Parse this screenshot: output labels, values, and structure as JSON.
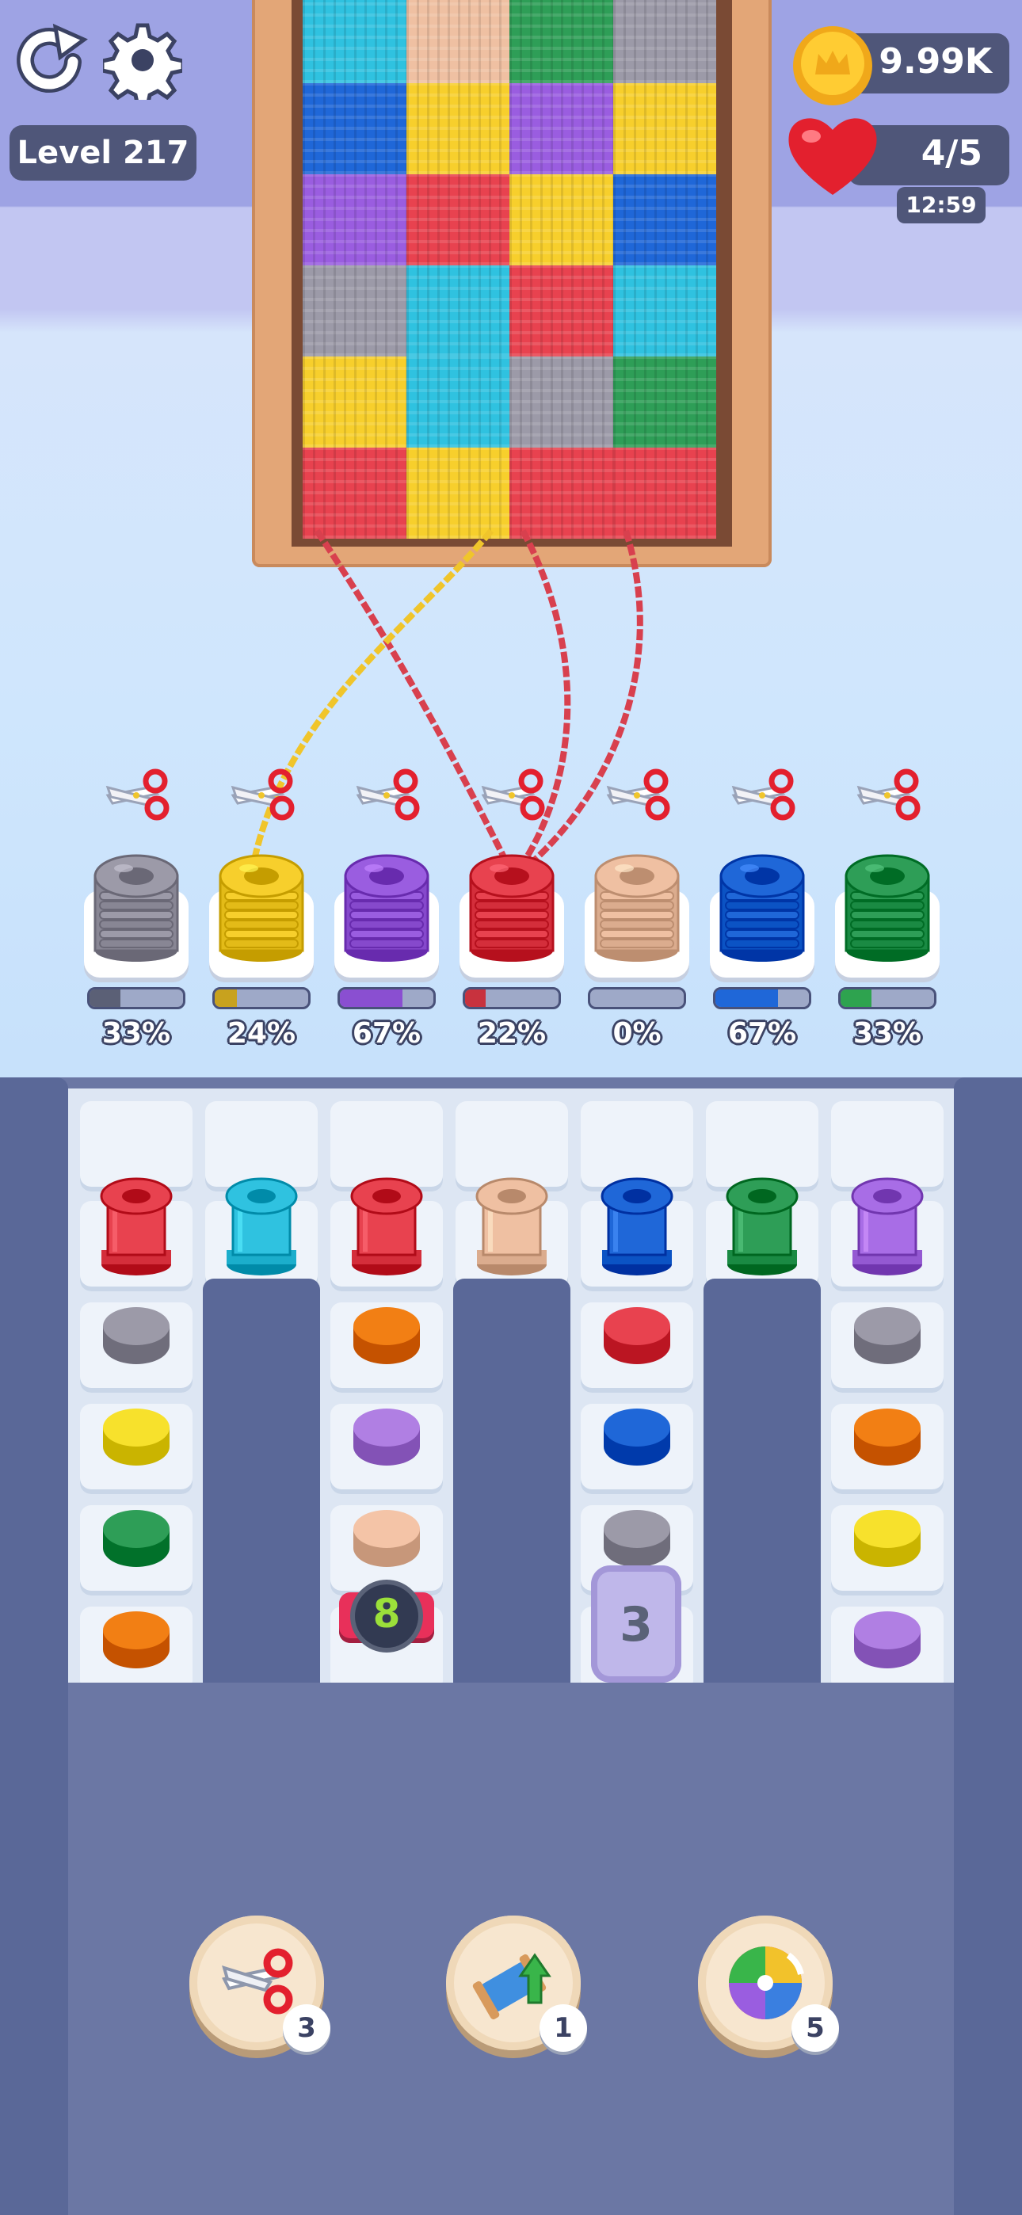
{
  "hud": {
    "level_label": "Level 217",
    "coins": "9.99K",
    "lives": "4/5",
    "life_timer": "12:59",
    "icons": [
      "restart-icon",
      "settings-icon",
      "coin-icon",
      "heart-icon"
    ]
  },
  "knit_board": {
    "columns": [
      [
        "#2fc2e0",
        "#1f67d8",
        "#9a5de0",
        "#9c9aa8",
        "#f7cf2c",
        "#e8424f"
      ],
      [
        "#efc0a2",
        "#f7cf2c",
        "#e8424f",
        "#2fc2e0",
        "#2fc2e0",
        "#f7cf2c"
      ],
      [
        "#2e9e57",
        "#9a5de0",
        "#f7cf2c",
        "#e8424f",
        "#9c9aa8",
        "#e8424f"
      ],
      [
        "#9c9aa8",
        "#f7cf2c",
        "#1f67d8",
        "#2fc2e0",
        "#2e9e57",
        "#e8424f"
      ]
    ]
  },
  "spools": [
    {
      "color": "#9c9aa8",
      "progress_pct": "33%",
      "progress": 0.33,
      "fill": "#5b6076"
    },
    {
      "color": "#f7cf2c",
      "progress_pct": "24%",
      "progress": 0.24,
      "fill": "#c8a21e"
    },
    {
      "color": "#9a5de0",
      "progress_pct": "67%",
      "progress": 0.67,
      "fill": "#8a4fd1"
    },
    {
      "color": "#e8424f",
      "progress_pct": "22%",
      "progress": 0.22,
      "fill": "#c8323e"
    },
    {
      "color": "#efc0a2",
      "progress_pct": "0%",
      "progress": 0.0,
      "fill": "#d09e80"
    },
    {
      "color": "#1f67d8",
      "progress_pct": "67%",
      "progress": 0.67,
      "fill": "#1f67d8"
    },
    {
      "color": "#2e9e57",
      "progress_pct": "33%",
      "progress": 0.33,
      "fill": "#2ea34f"
    }
  ],
  "grid": {
    "columns": [
      {
        "spool": "#e8424f",
        "cells": [
          "#9c9aa8",
          "#f7e12c",
          "#2e9e57",
          "#f27f14"
        ]
      },
      {
        "spool": "#2fc2e0",
        "cells": []
      },
      {
        "spool": "#e8424f",
        "cells": [
          "#f27f14",
          "#b07fe3",
          "#f4c4a7",
          "#9c9aa8"
        ]
      },
      {
        "spool": "#efc0a2",
        "cells": []
      },
      {
        "spool": "#1f67d8",
        "cells": [
          "#e8424f",
          "#1f67d8",
          "#9c9aa8",
          "#b6b4d8"
        ]
      },
      {
        "spool": "#2e9e57",
        "cells": []
      },
      {
        "spool": "#a86de6",
        "cells": [
          "#9c9aa8",
          "#f27f14",
          "#f7e12c",
          "#b07fe3"
        ]
      }
    ],
    "locked_count": "8",
    "hidden_count": "3"
  },
  "boosters": [
    {
      "name": "scissors",
      "count": "3"
    },
    {
      "name": "spool-upgrade",
      "count": "1"
    },
    {
      "name": "color-wheel",
      "count": "5"
    }
  ]
}
